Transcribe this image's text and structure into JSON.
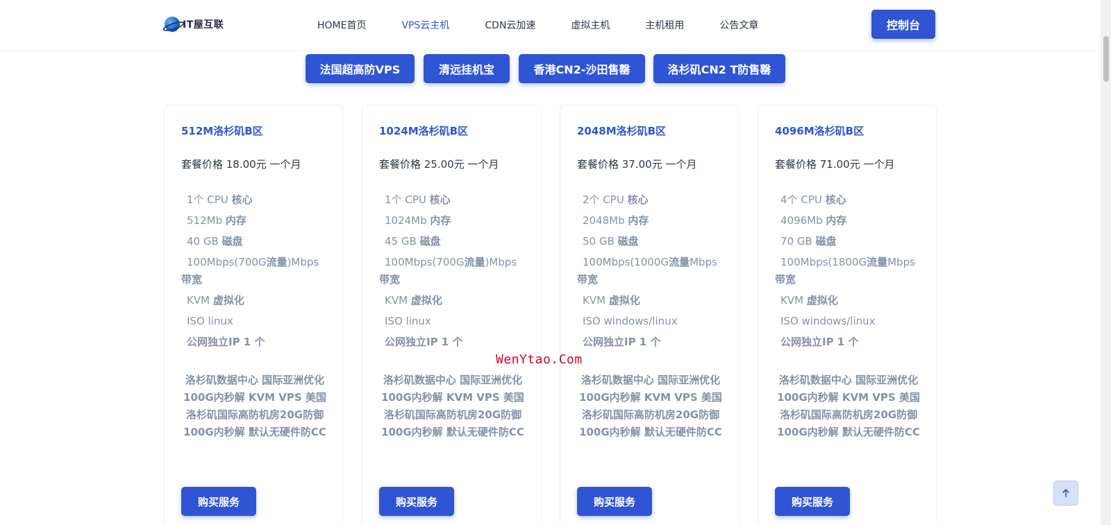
{
  "header": {
    "logo_text": "IT屋互联",
    "nav": [
      {
        "label": "HOME首页",
        "active": false
      },
      {
        "label": "VPS云主机",
        "active": true
      },
      {
        "label": "CDN云加速",
        "active": false
      },
      {
        "label": "虚拟主机",
        "active": false
      },
      {
        "label": "主机租用",
        "active": false
      },
      {
        "label": "公告文章",
        "active": false
      }
    ],
    "console_label": "控制台"
  },
  "categories": [
    "法国超高防VPS",
    "清远挂机宝",
    "香港CN2-沙田售罄",
    "洛杉矶CN2 T防售罄"
  ],
  "plans": [
    {
      "title": "512M洛杉矶B区",
      "price": "套餐价格 18.00元 一个月",
      "cpu": "1个 CPU",
      "cpu_unit": "核心",
      "ram": "512Mb",
      "ram_unit": "内存",
      "disk": "40 GB",
      "disk_unit": "磁盘",
      "bandwidth": "100Mbps(700G",
      "bandwidth_flow": "流量",
      "bandwidth_tail": ")Mbps",
      "bandwidth_unit": "带宽",
      "virt": "KVM",
      "virt_unit": "虚拟化",
      "iso": "ISO linux",
      "ip": "公网独立IP 1 个",
      "desc": "洛杉矶数据中心 国际亚洲优化 100G内秒解 KVM VPS 美国洛杉矶国际高防机房20G防御 100G内秒解 默认无硬件防CC",
      "buy_label": "购买服务"
    },
    {
      "title": "1024M洛杉矶B区",
      "price": "套餐价格 25.00元 一个月",
      "cpu": "1个 CPU",
      "cpu_unit": "核心",
      "ram": "1024Mb",
      "ram_unit": "内存",
      "disk": "45 GB",
      "disk_unit": "磁盘",
      "bandwidth": "100Mbps(700G",
      "bandwidth_flow": "流量",
      "bandwidth_tail": ")Mbps",
      "bandwidth_unit": "带宽",
      "virt": "KVM",
      "virt_unit": "虚拟化",
      "iso": "ISO linux",
      "ip": "公网独立IP 1 个",
      "desc": "洛杉矶数据中心 国际亚洲优化 100G内秒解 KVM VPS 美国洛杉矶国际高防机房20G防御 100G内秒解 默认无硬件防CC",
      "buy_label": "购买服务"
    },
    {
      "title": "2048M洛杉矶B区",
      "price": "套餐价格 37.00元 一个月",
      "cpu": "2个 CPU",
      "cpu_unit": "核心",
      "ram": "2048Mb",
      "ram_unit": "内存",
      "disk": "50 GB",
      "disk_unit": "磁盘",
      "bandwidth": "100Mbps(1000G",
      "bandwidth_flow": "流量",
      "bandwidth_tail": "Mbps",
      "bandwidth_unit": "带宽",
      "virt": "KVM",
      "virt_unit": "虚拟化",
      "iso": "ISO windows/linux",
      "ip": "公网独立IP 1 个",
      "desc": "洛杉矶数据中心 国际亚洲优化 100G内秒解 KVM VPS 美国洛杉矶国际高防机房20G防御 100G内秒解 默认无硬件防CC",
      "buy_label": "购买服务"
    },
    {
      "title": "4096M洛杉矶B区",
      "price": "套餐价格 71.00元 一个月",
      "cpu": "4个 CPU",
      "cpu_unit": "核心",
      "ram": "4096Mb",
      "ram_unit": "内存",
      "disk": "70 GB",
      "disk_unit": "磁盘",
      "bandwidth": "100Mbps(1800G",
      "bandwidth_flow": "流量",
      "bandwidth_tail": "Mbps",
      "bandwidth_unit": "带宽",
      "virt": "KVM",
      "virt_unit": "虚拟化",
      "iso": "ISO windows/linux",
      "ip": "公网独立IP 1 个",
      "desc": "洛杉矶数据中心 国际亚洲优化 100G内秒解 KVM VPS 美国洛杉矶国际高防机房20G防御 100G内秒解 默认无硬件防CC",
      "buy_label": "购买服务"
    }
  ],
  "watermark": "WenYtao.Com",
  "colors": {
    "accent": "#2f55d4",
    "muted_text": "#8492a6",
    "watermark": "#d0021b"
  },
  "icons": {
    "back_to_top": "arrow-up-icon",
    "logo": "globe-icon"
  }
}
